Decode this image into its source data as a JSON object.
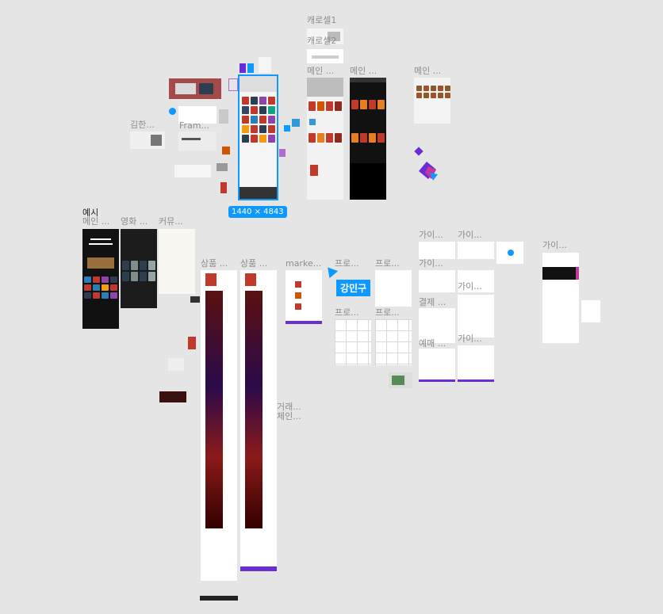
{
  "canvas": {
    "labels": {
      "carousel1": "캐로셀1",
      "carousel2": "캐로셀2",
      "main_1": "메인 ...",
      "main_2": "메인 ...",
      "main_3": "메인 ...",
      "kim": "김한...",
      "frame": "Fram...",
      "example": "예시",
      "main_4": "메인 ...",
      "movie": "영화 ...",
      "community": "커뮤...",
      "product_1": "상품 ...",
      "product_2": "상품 ...",
      "marke": "marke...",
      "pro_1": "프로...",
      "pro_2": "프로...",
      "pro_3": "프로...",
      "pro_4": "프로...",
      "guide_1": "가이...",
      "guide_2": "가이...",
      "guide_3": "가이...",
      "guide_4": "가이...",
      "guide_5": "가이...",
      "guide_6": "가이...",
      "payment": "결제 ...",
      "reserve": "예매 ...",
      "trade": "거래...",
      "chain": "체인..."
    },
    "selection_size": "1440 × 4843",
    "collaborator_name": "강민구"
  },
  "colors": {
    "canvas_bg": "#e5e5e5",
    "selection": "#0d99ff",
    "accent_red": "#c0392b",
    "accent_purple": "#6a2cd6"
  }
}
